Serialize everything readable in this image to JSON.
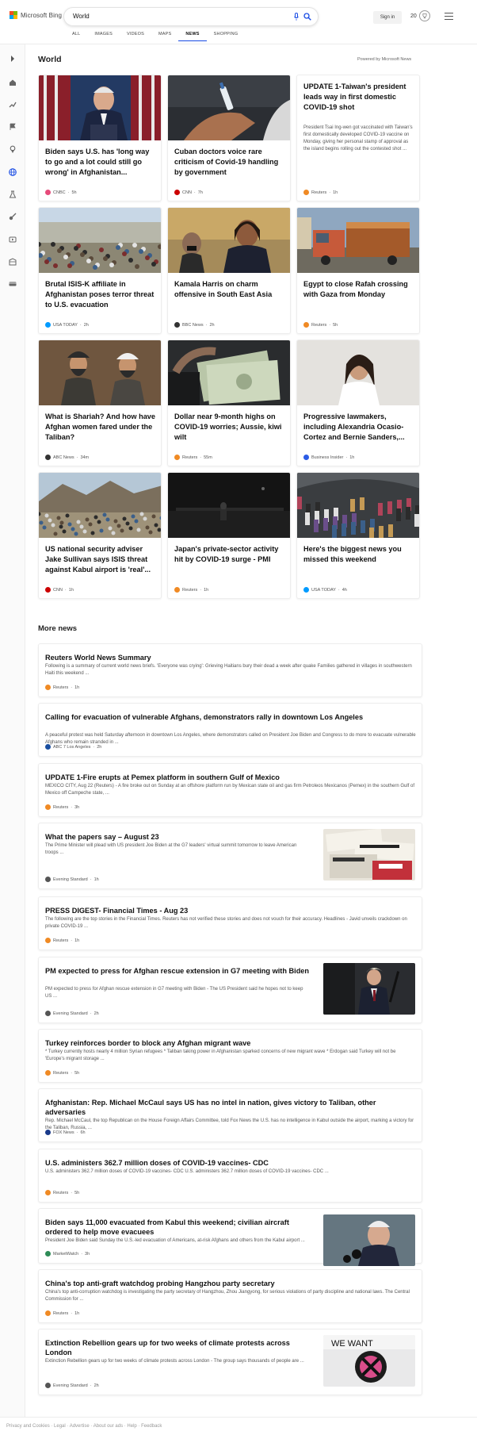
{
  "header": {
    "logo_text": "Microsoft Bing",
    "query": "World",
    "signin_label": "Sign in",
    "rewards_count": "20",
    "scopes": [
      {
        "label": "ALL",
        "active": false
      },
      {
        "label": "IMAGES",
        "active": false
      },
      {
        "label": "VIDEOS",
        "active": false
      },
      {
        "label": "MAPS",
        "active": false
      },
      {
        "label": "NEWS",
        "active": true
      },
      {
        "label": "SHOPPING",
        "active": false
      }
    ]
  },
  "sidebar": {
    "icons": [
      "expand-icon",
      "home-icon",
      "trending-icon",
      "flag-icon",
      "location-icon",
      "globe-icon",
      "science-icon",
      "sports-icon",
      "video-icon",
      "entertainment-icon",
      "money-icon"
    ]
  },
  "world": {
    "title": "World",
    "powered_by": "Powered by Microsoft News",
    "cards": [
      {
        "headline": "Biden says U.S. has 'long way to go and a lot could still go wrong' in Afghanistan...",
        "source": "CNBC",
        "time": "5h",
        "src_color": "#e64a7a",
        "image": "biden-podium"
      },
      {
        "headline": "Cuban doctors voice rare criticism of Covid-19 handling by government",
        "source": "CNN",
        "time": "7h",
        "src_color": "#cc0000",
        "image": "vaccine"
      },
      {
        "headline": "UPDATE 1-Taiwan's president leads way in first domestic COVID-19 shot",
        "snippet": "President Tsai Ing-wen got vaccinated with Taiwan's first domestically developed COVID-19 vaccine on Monday, giving her personal stamp of approval as the island begins rolling out the contested shot ...",
        "source": "Reuters",
        "time": "1h",
        "src_color": "#f08a24",
        "image": ""
      },
      {
        "headline": "Brutal ISIS-K affiliate in Afghanistan poses terror threat to U.S. evacuation",
        "source": "USA TODAY",
        "time": "2h",
        "src_color": "#009bff",
        "image": "crowd-airport"
      },
      {
        "headline": "Kamala Harris on charm offensive in South East Asia",
        "source": "BBC News",
        "time": "2h",
        "src_color": "#333333",
        "image": "harris"
      },
      {
        "headline": "Egypt to close Rafah crossing with Gaza from Monday",
        "source": "Reuters",
        "time": "5h",
        "src_color": "#f08a24",
        "image": "truck"
      },
      {
        "headline": "What is Shariah? And how have Afghan women fared under the Taliban?",
        "source": "ABC News",
        "time": "34m",
        "src_color": "#333333",
        "image": "taliban"
      },
      {
        "headline": "Dollar near 9-month highs on COVID-19 worries; Aussie, kiwi wilt",
        "source": "Reuters",
        "time": "55m",
        "src_color": "#f08a24",
        "image": "dollars"
      },
      {
        "headline": "Progressive lawmakers, including Alexandria Ocasio-Cortez and Bernie Sanders,...",
        "source": "Business Insider",
        "time": "1h",
        "src_color": "#2b5ce6",
        "image": "aoc"
      },
      {
        "headline": "US national security adviser Jake Sullivan says ISIS threat against Kabul airport is 'real'...",
        "source": "CNN",
        "time": "1h",
        "src_color": "#cc0000",
        "image": "kabul-crowd"
      },
      {
        "headline": "Japan's private-sector activity hit by COVID-19 surge - PMI",
        "source": "Reuters",
        "time": "1h",
        "src_color": "#f08a24",
        "image": "dark-street"
      },
      {
        "headline": "Here's the biggest news you missed this weekend",
        "source": "USA TODAY",
        "time": "4h",
        "src_color": "#009bff",
        "image": "plane-evac"
      }
    ]
  },
  "more_news": {
    "title": "More news",
    "items": [
      {
        "headline": "Reuters World News Summary",
        "snippet": "Following is a summary of current world news briefs. 'Everyone was crying': Grieving Haitians bury their dead a week after quake Families gathered in villages in southwestern Haiti this weekend ...",
        "source": "Reuters",
        "time": "1h",
        "src_color": "#f08a24",
        "thumb": ""
      },
      {
        "headline": "Calling for evacuation of vulnerable Afghans, demonstrators rally in downtown Los Angeles",
        "snippet": "A peaceful protest was held Saturday afternoon in downtown Los Angeles, where demonstrators called on President Joe Biden and Congress to do more to evacuate vulnerable Afghans who remain stranded in ...",
        "source": "ABC 7 Los Angeles",
        "time": "2h",
        "src_color": "#1a4fa0",
        "thumb": ""
      },
      {
        "headline": "UPDATE 1-Fire erupts at Pemex platform in southern Gulf of Mexico",
        "snippet": "MEXICO CITY, Aug 22 (Reuters) - A fire broke out on Sunday at an offshore platform run by Mexican state oil and gas firm Petroleos Mexicanos (Pemex) in the southern Gulf of Mexico off Campeche state, ...",
        "source": "Reuters",
        "time": "3h",
        "src_color": "#f08a24",
        "thumb": ""
      },
      {
        "headline": "What the papers say – August 23",
        "snippet": "The Prime Minister will plead with US president Joe Biden at the G7 leaders' virtual summit tomorrow to leave American troops ...",
        "source": "Evening Standard",
        "time": "1h",
        "src_color": "#555555",
        "thumb": "papers"
      },
      {
        "headline": "PRESS DIGEST- Financial Times - Aug 23",
        "snippet": "The following are the top stories in the Financial Times. Reuters has not verified these stories and does not vouch for their accuracy. Headlines - Javid unveils crackdown on private COVID-19 ...",
        "source": "Reuters",
        "time": "1h",
        "src_color": "#f08a24",
        "thumb": ""
      },
      {
        "headline": "PM expected to press for Afghan rescue extension in G7 meeting with Biden",
        "snippet": "PM expected to press for Afghan rescue extension in G7 meeting with Biden - The US President said he hopes not to keep US ...",
        "source": "Evening Standard",
        "time": "2h",
        "src_color": "#555555",
        "thumb": "johnson"
      },
      {
        "headline": "Turkey reinforces border to block any Afghan migrant wave",
        "snippet": "* Turkey currently hosts nearly 4 million Syrian refugees * Taliban taking power in Afghanistan sparked concerns of new migrant wave * Erdogan said Turkey will not be 'Europe's migrant storage ...",
        "source": "Reuters",
        "time": "5h",
        "src_color": "#f08a24",
        "thumb": ""
      },
      {
        "headline": "Afghanistan: Rep. Michael McCaul says US has no intel in nation, gives victory to Taliban, other adversaries",
        "snippet": "Rep. Michael McCaul, the top Republican on the House Foreign Affairs Committee, told Fox News the U.S. has no intelligence in Kabul outside the airport, marking a victory for the Taliban, Russia, ...",
        "source": "FOX News",
        "time": "6h",
        "src_color": "#1a3a8a",
        "thumb": ""
      },
      {
        "headline": "U.S. administers 362.7 million doses of COVID-19 vaccines- CDC",
        "snippet": "U.S. administers 362.7 million doses of COVID-19 vaccines- CDC U.S. administers 362.7 million doses of COVID-19 vaccines- CDC ...",
        "source": "Reuters",
        "time": "5h",
        "src_color": "#f08a24",
        "thumb": ""
      },
      {
        "headline": "Biden says 11,000 evacuated from Kabul this weekend; civilian aircraft ordered to help move evacuees",
        "snippet": "President Joe Biden said Sunday the U.S.-led evacuation of Americans, at-risk Afghans and others from the Kabul airport ...",
        "source": "MarketWatch",
        "time": "3h",
        "src_color": "#2e8b57",
        "thumb": "biden-mic"
      },
      {
        "headline": "China's top anti-graft watchdog probing Hangzhou party secretary",
        "snippet": "China's top anti-corruption watchdog is investigating the party secretary of Hangzhou, Zhou Jiangyong, for serious violations of party discipline and national laws. The Central Commission for ...",
        "source": "Reuters",
        "time": "1h",
        "src_color": "#f08a24",
        "thumb": ""
      },
      {
        "headline": "Extinction Rebellion gears up for two weeks of climate protests across London",
        "snippet": "Extinction Rebellion gears up for two weeks of climate protests across London - The group says thousands of people are ...",
        "source": "Evening Standard",
        "time": "2h",
        "src_color": "#555555",
        "thumb": "xr"
      }
    ]
  },
  "footer": {
    "text": "Privacy and Cookies · Legal · Advertise · About our ads · Help · Feedback"
  }
}
